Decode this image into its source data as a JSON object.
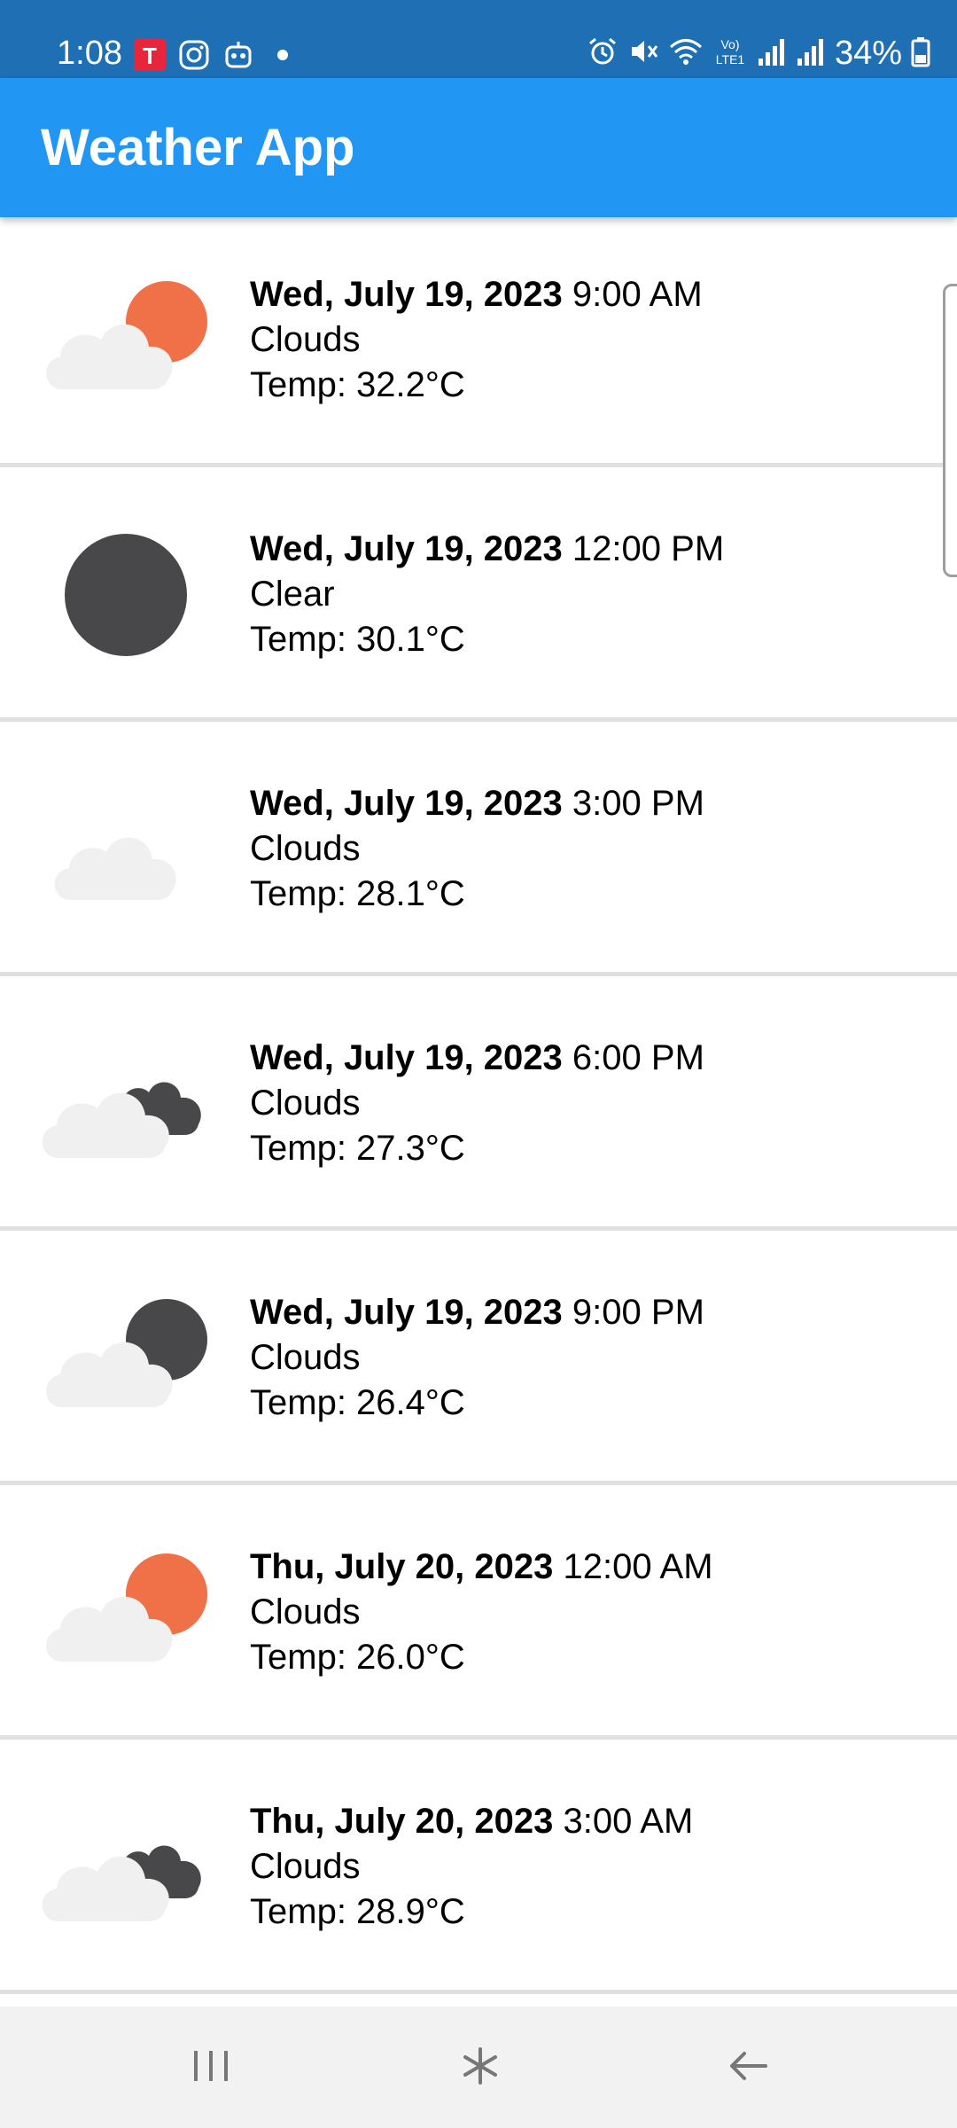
{
  "status_bar": {
    "time": "1:08",
    "battery": "34%",
    "left_icons": [
      "tmobile-app-icon",
      "instagram-icon",
      "robot-app-icon",
      "dot-icon"
    ],
    "right_icons": [
      "alarm-icon",
      "mute-icon",
      "wifi-icon",
      "volte-icon",
      "signal-icon",
      "signal-icon",
      "battery-icon"
    ]
  },
  "app_bar": {
    "title": "Weather App"
  },
  "forecasts": [
    {
      "date": "Wed, July 19, 2023",
      "time": "9:00 AM",
      "condition": "Clouds",
      "temp": "Temp: 32.2°C",
      "icon": "partly-cloudy-day-icon"
    },
    {
      "date": "Wed, July 19, 2023",
      "time": "12:00 PM",
      "condition": "Clear",
      "temp": "Temp: 30.1°C",
      "icon": "clear-night-icon"
    },
    {
      "date": "Wed, July 19, 2023",
      "time": "3:00 PM",
      "condition": "Clouds",
      "temp": "Temp: 28.1°C",
      "icon": "cloud-icon"
    },
    {
      "date": "Wed, July 19, 2023",
      "time": "6:00 PM",
      "condition": "Clouds",
      "temp": "Temp: 27.3°C",
      "icon": "broken-clouds-icon"
    },
    {
      "date": "Wed, July 19, 2023",
      "time": "9:00 PM",
      "condition": "Clouds",
      "temp": "Temp: 26.4°C",
      "icon": "partly-cloudy-night-icon"
    },
    {
      "date": "Thu, July 20, 2023",
      "time": "12:00 AM",
      "condition": "Clouds",
      "temp": "Temp: 26.0°C",
      "icon": "partly-cloudy-day-icon"
    },
    {
      "date": "Thu, July 20, 2023",
      "time": "3:00 AM",
      "condition": "Clouds",
      "temp": "Temp: 28.9°C",
      "icon": "broken-clouds-icon"
    }
  ],
  "nav_bar": {
    "buttons": [
      "recents-icon",
      "home-icon",
      "back-icon"
    ]
  },
  "colors": {
    "app_bar": "#2196f3",
    "status_bar": "#1e6fb3",
    "sun": "#f07048",
    "moon": "#48484a",
    "cloud": "#f0f0f0"
  }
}
